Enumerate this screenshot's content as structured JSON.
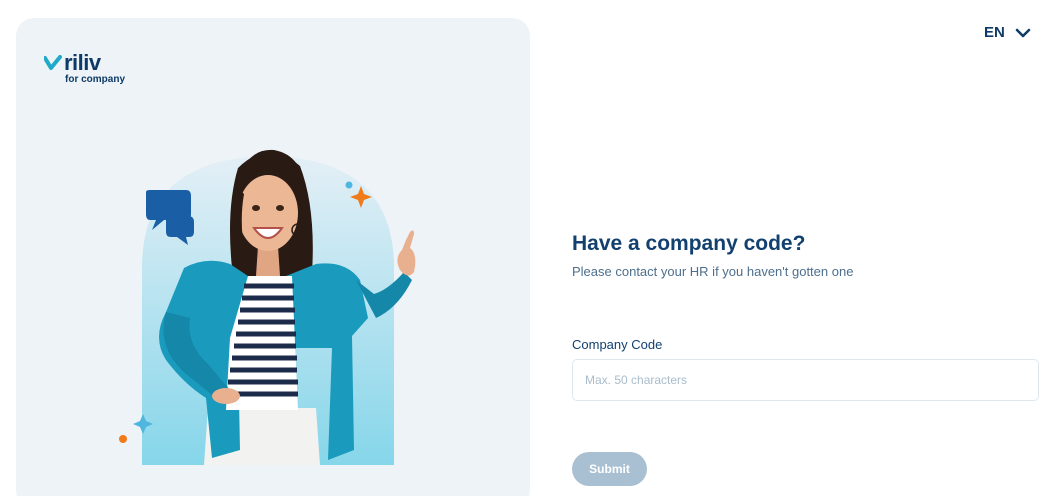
{
  "brand": {
    "name": "riliv",
    "tagline": "for company",
    "colors": {
      "navy": "#0d3a66",
      "teal": "#21a9c9",
      "orange": "#f07b1a",
      "button_disabled": "#a9c0d2"
    }
  },
  "language": {
    "code": "EN",
    "icon": "chevron-down-icon"
  },
  "form": {
    "heading": "Have a company code?",
    "subheading": "Please contact your HR if you haven't gotten one",
    "code_label": "Company Code",
    "code_placeholder": "Max. 50 characters",
    "code_value": "",
    "submit_label": "Submit"
  },
  "illustration": {
    "icons": [
      "chat-bubbles-icon",
      "sparkle-icon",
      "dot-icon"
    ]
  }
}
